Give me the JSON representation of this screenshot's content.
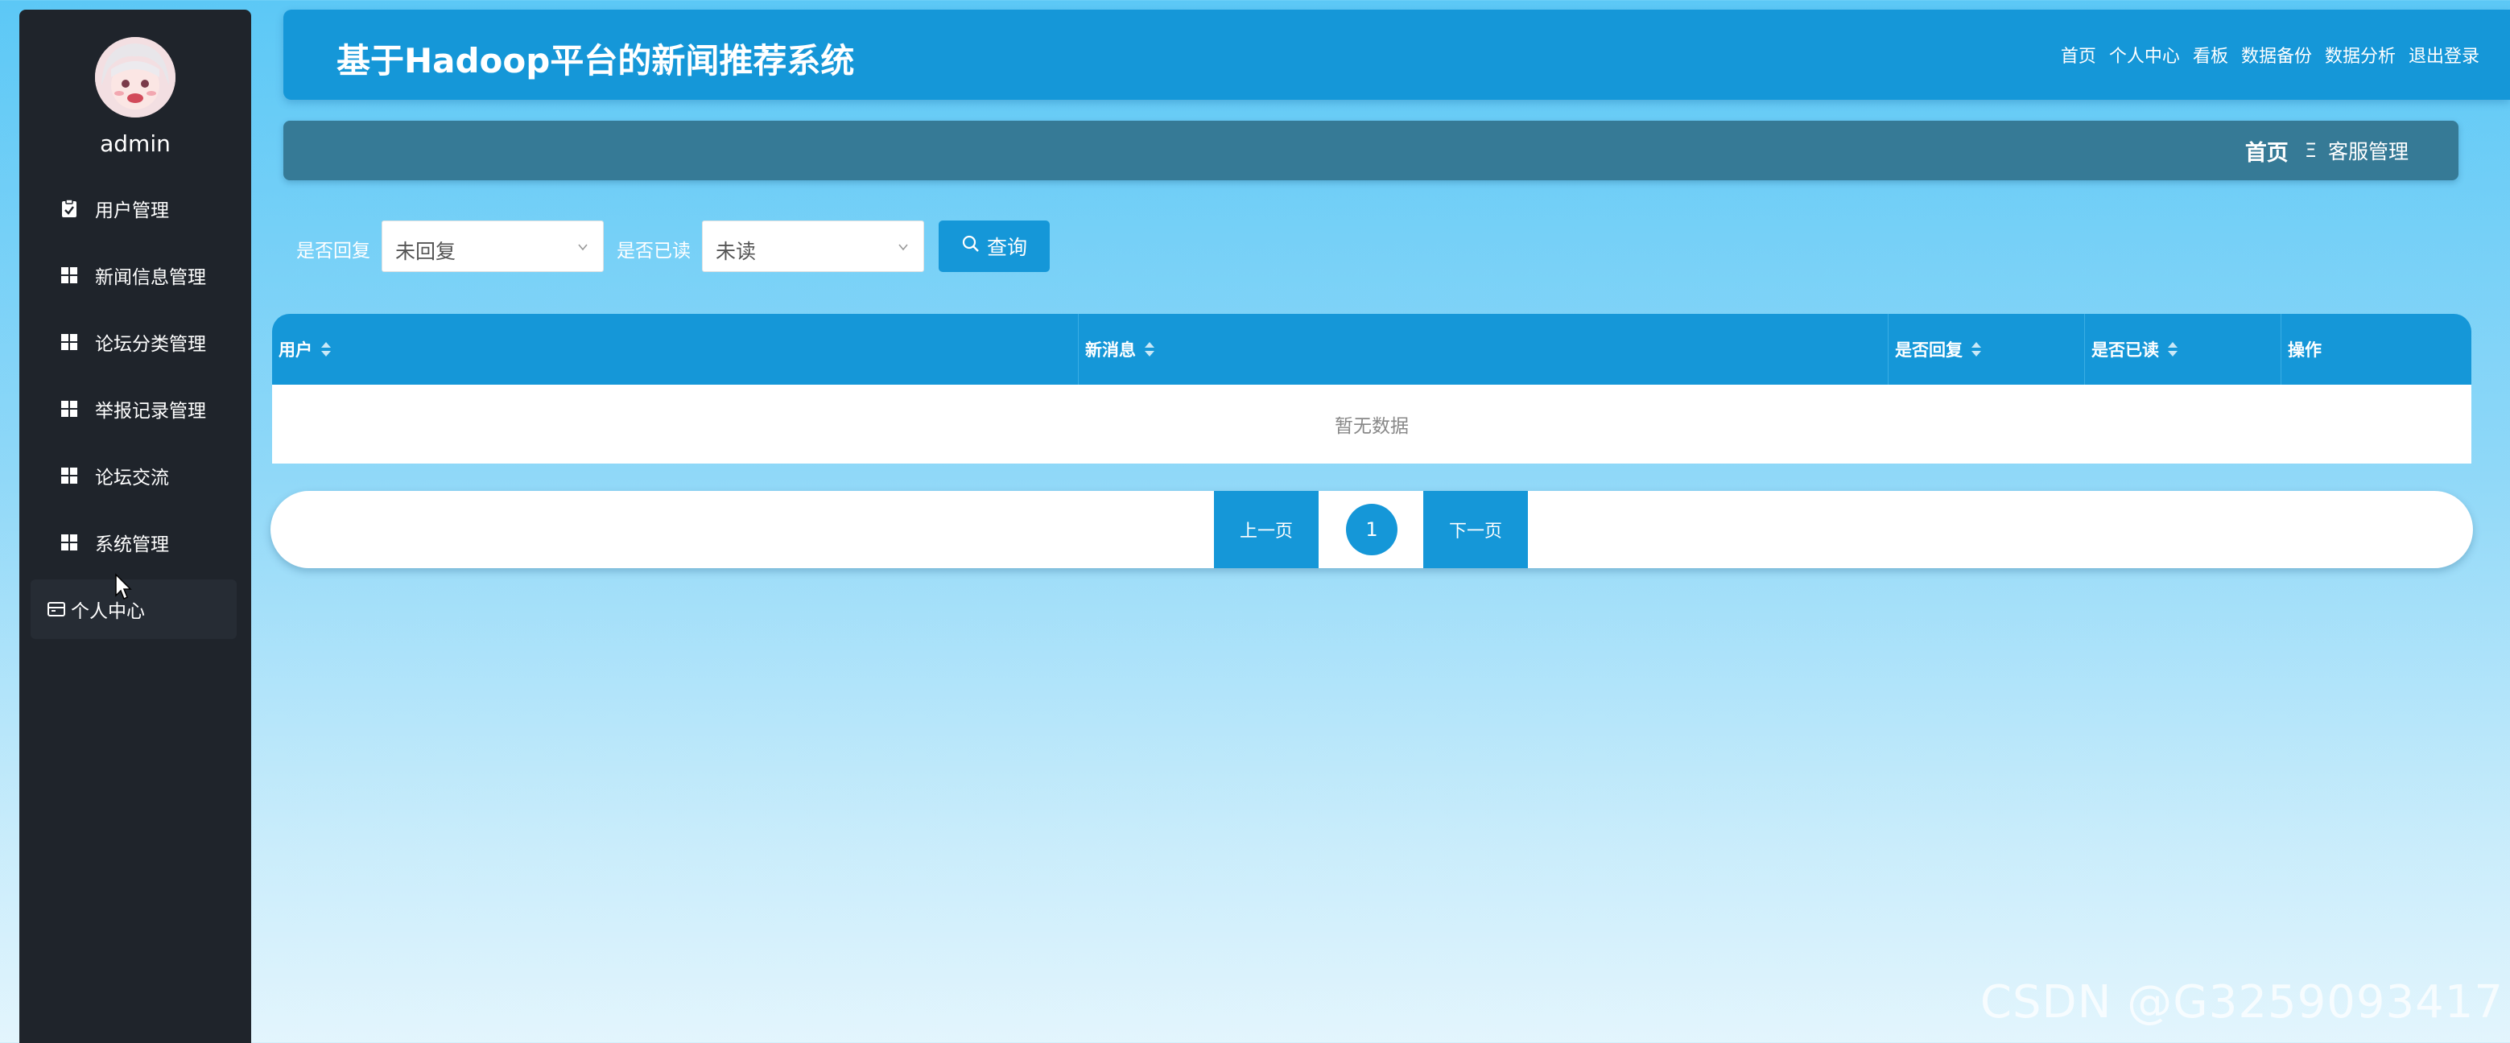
{
  "app": {
    "title": "基于Hadoop平台的新闻推荐系统"
  },
  "top_nav": {
    "items": [
      "首页",
      "个人中心",
      "看板",
      "数据备份",
      "数据分析",
      "退出登录"
    ]
  },
  "sidebar": {
    "username": "admin",
    "items": [
      {
        "label": "用户管理",
        "icon": "clipboard-check-icon"
      },
      {
        "label": "新闻信息管理",
        "icon": "grid-icon"
      },
      {
        "label": "论坛分类管理",
        "icon": "grid-icon"
      },
      {
        "label": "举报记录管理",
        "icon": "grid-icon"
      },
      {
        "label": "论坛交流",
        "icon": "grid-icon"
      },
      {
        "label": "系统管理",
        "icon": "grid-icon"
      },
      {
        "label": "个人中心",
        "icon": "wallet-icon"
      }
    ]
  },
  "breadcrumb": {
    "home": "首页",
    "separator": "Ξ",
    "current": "客服管理"
  },
  "filters": {
    "replied_label": "是否回复",
    "replied_value": "未回复",
    "read_label": "是否已读",
    "read_value": "未读",
    "query_label": "查询"
  },
  "table": {
    "columns": [
      "用户",
      "新消息",
      "是否回复",
      "是否已读",
      "操作"
    ],
    "empty_text": "暂无数据"
  },
  "pagination": {
    "prev_label": "上一页",
    "current_page": "1",
    "next_label": "下一页"
  },
  "watermark": "CSDN @G3259093417",
  "colors": {
    "primary": "#1597d8",
    "sidebar": "#1f242b",
    "breadcrumb_bar": "#367a96"
  }
}
